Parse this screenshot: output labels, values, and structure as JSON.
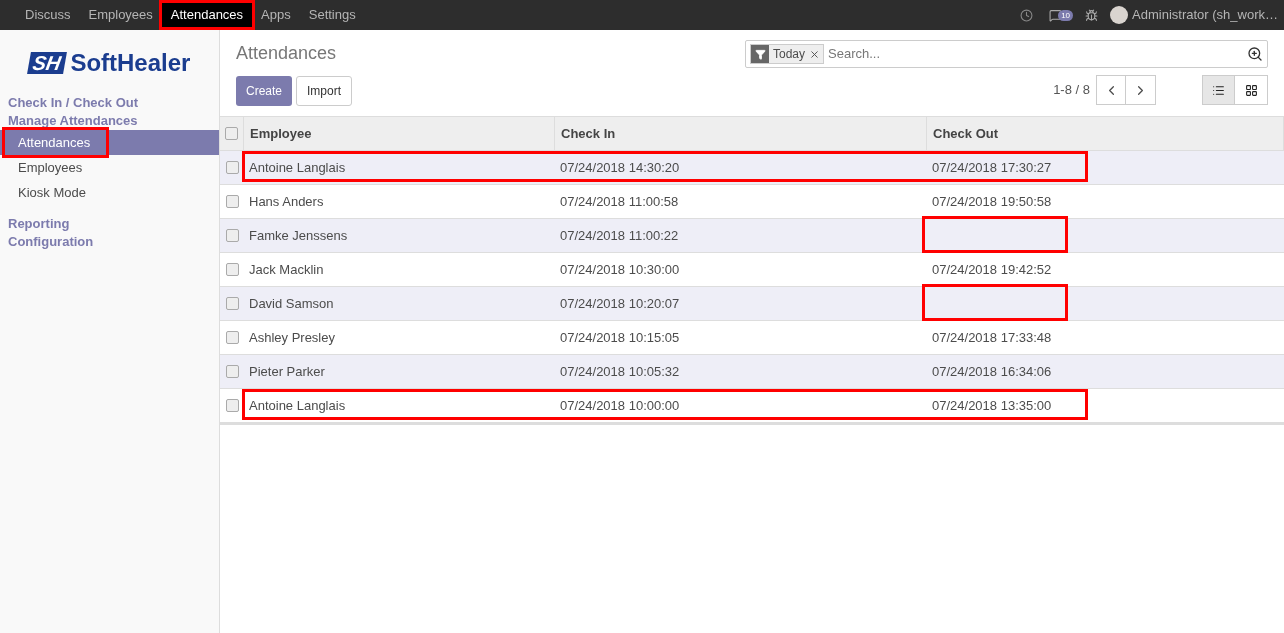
{
  "top_menu": [
    {
      "label": "Discuss",
      "selected": false,
      "highlighted": false
    },
    {
      "label": "Employees",
      "selected": false,
      "highlighted": false
    },
    {
      "label": "Attendances",
      "selected": true,
      "highlighted": true
    },
    {
      "label": "Apps",
      "selected": false,
      "highlighted": false
    },
    {
      "label": "Settings",
      "selected": false,
      "highlighted": false
    }
  ],
  "systray": {
    "messages_count": "10",
    "user": "Administrator (sh_work…"
  },
  "sidebar": {
    "logo_mark": "SH",
    "logo_text": "SoftHealer",
    "sections": [
      {
        "label": "Check In / Check Out"
      },
      {
        "label": "Manage Attendances",
        "items": [
          {
            "label": "Attendances",
            "selected": true,
            "highlighted": true
          },
          {
            "label": "Employees",
            "selected": false,
            "highlighted": false
          },
          {
            "label": "Kiosk Mode",
            "selected": false,
            "highlighted": false
          }
        ]
      },
      {
        "label": "Reporting"
      },
      {
        "label": "Configuration"
      }
    ]
  },
  "breadcrumb": "Attendances",
  "search": {
    "facet": "Today",
    "placeholder": "Search..."
  },
  "buttons": [
    "Create",
    "Import"
  ],
  "pager": "1-8 / 8",
  "views": [
    {
      "kind": "list",
      "selected": true
    },
    {
      "kind": "kanban",
      "selected": false
    }
  ],
  "table": {
    "columns": [
      "Employee",
      "Check In",
      "Check Out"
    ],
    "all_checked": false,
    "rows": [
      {
        "kind": "highlighted_row",
        "checked": false,
        "employee": "Antoine Langlais",
        "check_in": "07/24/2018 14:30:20",
        "check_out": "07/24/2018 17:30:27"
      },
      {
        "kind": "plain",
        "checked": false,
        "employee": "Hans Anders",
        "check_in": "07/24/2018 11:00:58",
        "check_out": "07/24/2018 19:50:58"
      },
      {
        "kind": "highlighted_check_out",
        "checked": false,
        "employee": "Famke Jenssens",
        "check_in": "07/24/2018 11:00:22"
      },
      {
        "kind": "plain",
        "checked": false,
        "employee": "Jack Macklin",
        "check_in": "07/24/2018 10:30:00",
        "check_out": "07/24/2018 19:42:52"
      },
      {
        "kind": "highlighted_check_out",
        "checked": false,
        "employee": "David Samson",
        "check_in": "07/24/2018 10:20:07"
      },
      {
        "kind": "plain",
        "checked": false,
        "employee": "Ashley Presley",
        "check_in": "07/24/2018 10:15:05",
        "check_out": "07/24/2018 17:33:48"
      },
      {
        "kind": "plain",
        "checked": false,
        "employee": "Pieter Parker",
        "check_in": "07/24/2018 10:05:32",
        "check_out": "07/24/2018 16:34:06"
      },
      {
        "kind": "highlighted_row",
        "checked": false,
        "employee": "Antoine Langlais",
        "check_in": "07/24/2018 10:00:00",
        "check_out": "07/24/2018 13:35:00"
      }
    ]
  }
}
